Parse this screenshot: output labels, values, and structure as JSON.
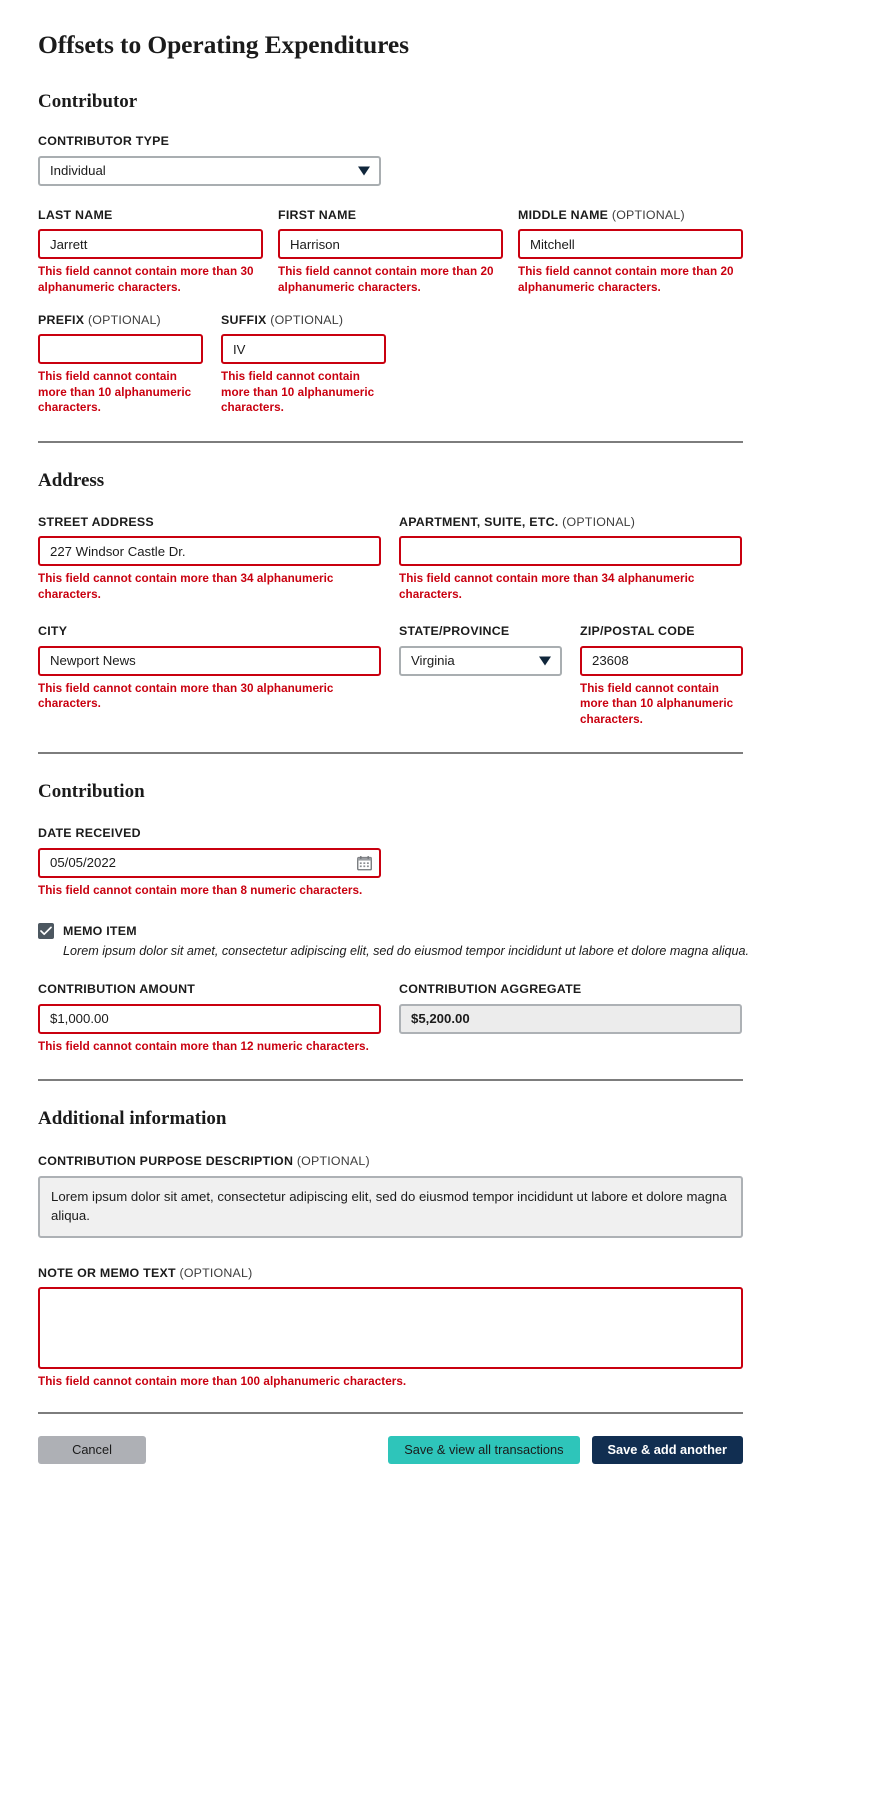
{
  "page": {
    "title": "Offsets to Operating Expenditures"
  },
  "sections": {
    "contributor": {
      "heading": "Contributor",
      "contributor_type": {
        "label": "CONTRIBUTOR TYPE",
        "value": "Individual",
        "options": [
          "Individual"
        ]
      },
      "last_name": {
        "label": "LAST NAME",
        "value": "Jarrett",
        "error": "This field cannot contain more than 30 alphanumeric characters."
      },
      "first_name": {
        "label": "FIRST NAME",
        "value": "Harrison",
        "error": "This field cannot contain more than 20 alphanumeric characters."
      },
      "middle_name": {
        "label": "MIDDLE NAME",
        "optional": "(OPTIONAL)",
        "value": "Mitchell",
        "error": "This field cannot contain more than 20 alphanumeric characters."
      },
      "prefix": {
        "label": "PREFIX",
        "optional": "(OPTIONAL)",
        "value": "",
        "error": "This field cannot contain more than 10 alphanumeric characters."
      },
      "suffix": {
        "label": "SUFFIX",
        "optional": "(OPTIONAL)",
        "value": "IV",
        "error": "This field cannot contain more than 10 alphanumeric characters."
      }
    },
    "address": {
      "heading": "Address",
      "street": {
        "label": "STREET ADDRESS",
        "value": "227 Windsor Castle Dr.",
        "error": "This field cannot contain more than 34 alphanumeric characters."
      },
      "apartment": {
        "label": "APARTMENT, SUITE, ETC.",
        "optional": "(OPTIONAL)",
        "value": "",
        "error": "This field cannot contain more than 34 alphanumeric characters."
      },
      "city": {
        "label": "CITY",
        "value": "Newport News",
        "error": "This field cannot contain more than 30 alphanumeric characters."
      },
      "state": {
        "label": "STATE/PROVINCE",
        "value": "Virginia",
        "options": [
          "Virginia"
        ]
      },
      "zip": {
        "label": "ZIP/POSTAL CODE",
        "value": "23608",
        "error": "This field cannot contain more than 10 alphanumeric characters."
      }
    },
    "contribution": {
      "heading": "Contribution",
      "date_received": {
        "label": "DATE RECEIVED",
        "value": "05/05/2022",
        "error": "This field cannot contain more than 8 numeric characters."
      },
      "memo_item": {
        "label": "MEMO ITEM",
        "checked": true,
        "description": "Lorem ipsum dolor sit amet, consectetur adipiscing elit, sed do eiusmod tempor incididunt ut labore et dolore magna aliqua."
      },
      "amount": {
        "label": "CONTRIBUTION AMOUNT",
        "value": "$1,000.00",
        "error": "This field cannot contain more than 12 numeric characters."
      },
      "aggregate": {
        "label": "CONTRIBUTION AGGREGATE",
        "value": "$5,200.00"
      }
    },
    "additional": {
      "heading": "Additional information",
      "purpose": {
        "label": "CONTRIBUTION PURPOSE DESCRIPTION",
        "optional": "(OPTIONAL)",
        "value": "Lorem ipsum dolor sit amet, consectetur adipiscing elit, sed do eiusmod tempor incididunt ut labore et dolore magna aliqua."
      },
      "note": {
        "label": "NOTE OR MEMO TEXT",
        "optional": "(OPTIONAL)",
        "value": "",
        "error": "This field cannot contain more than 100 alphanumeric characters."
      }
    }
  },
  "footer": {
    "cancel": "Cancel",
    "save_view": "Save & view all transactions",
    "save_add": "Save & add another"
  },
  "colors": {
    "error_red": "#c9000f",
    "teal": "#2ec5ba",
    "navy": "#112e51",
    "cancel_gray": "#aeb0b5",
    "checkbox_slate": "#4c5760"
  },
  "icons": {
    "dropdown": "chevron-down-icon",
    "calendar": "calendar-icon",
    "check": "check-icon"
  }
}
